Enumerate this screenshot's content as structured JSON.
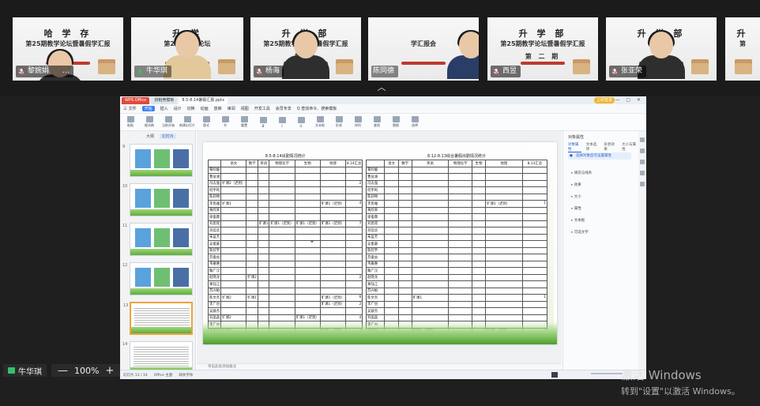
{
  "participants": [
    {
      "name": "黎婉娟",
      "slide_title": "哈 学 存",
      "slide_subtitle": "第25期教学论坛暨暑假学汇报",
      "slide_line3": "",
      "has_person": true,
      "muted": true,
      "more": "…"
    },
    {
      "name": "牛华琪",
      "slide_title": "升 学",
      "slide_subtitle": "第25期教学论坛",
      "slide_line3": "第",
      "has_person": true,
      "muted": false,
      "active": true
    },
    {
      "name": "杨海",
      "slide_title": "升 学 部",
      "slide_subtitle": "第25期教学论坛暨暑假学汇报",
      "slide_line3": "第 期",
      "has_person": true,
      "muted": true
    },
    {
      "name": "陈同德",
      "slide_title": "",
      "slide_subtitle": "学汇报会",
      "slide_line3": "",
      "has_person": true,
      "muted": false
    },
    {
      "name": "西昱",
      "slide_title": "升 学 部",
      "slide_subtitle": "第25期教学论坛暨暑假学汇报",
      "slide_line3": "第 二 期",
      "has_person": false,
      "muted": true
    },
    {
      "name": "张亚荣",
      "slide_title": "升 学 部",
      "slide_subtitle": "学汇报会",
      "slide_line3": "",
      "has_person": true,
      "muted": true
    },
    {
      "name": "",
      "slide_title": "升",
      "slide_subtitle": "第",
      "slide_line3": "",
      "has_person": false,
      "muted": false
    }
  ],
  "app": {
    "tabs": [
      "WPS Office",
      "找稻壳模板",
      "8.5-8.14暑假汇报.pptx"
    ],
    "login_label": "立即登录",
    "menus": [
      "三 文件",
      "开始",
      "插入",
      "设计",
      "切换",
      "动画",
      "放映",
      "审阅",
      "视图",
      "开发工具",
      "会员专享",
      "Q 查找命令、搜索模板"
    ],
    "active_menu": "开始",
    "ribbon": [
      "粘贴",
      "格式刷",
      "当前开始",
      "新建幻灯片",
      "版式",
      "节",
      "重置",
      "B",
      "I",
      "U",
      "文本框",
      "形状",
      "排列",
      "查找",
      "替换",
      "选择"
    ],
    "thumb_tabs": [
      "大纲",
      "幻灯片"
    ],
    "thumb_numbers": [
      "9",
      "10",
      "11",
      "12",
      "13",
      "14"
    ],
    "notes_placeholder": "单击此处添加备注",
    "status": [
      "幻灯片 13 / 14",
      "Office 主题",
      "缺失字体"
    ],
    "right_pane_title": "对象属性",
    "right_pane_tabs": [
      "对象属性",
      "文本选项",
      "形状效果",
      "大小与属性"
    ],
    "right_pane_info": "选择对象后可设置属性",
    "right_pane_items": [
      "填充与线条",
      "效果",
      "大小",
      "属性",
      "文本框",
      "可选文字"
    ]
  },
  "table_left": {
    "caption": "8.5-8.14出勤情况统计",
    "headers": [
      "",
      "语文",
      "数学",
      "英语",
      "物理化学",
      "生物",
      "地理",
      "8.14汇总"
    ],
    "rows": [
      [
        "覃欣媛",
        "",
        "",
        "",
        "",
        "",
        "",
        ""
      ],
      [
        "曹益涵",
        "",
        "",
        "",
        "",
        "",
        "",
        ""
      ],
      [
        "冯志强",
        "旷课2（迟到）",
        "",
        "",
        "",
        "",
        "",
        "2"
      ],
      [
        "何宇鸣",
        "",
        "",
        "",
        "",
        "",
        "",
        ""
      ],
      [
        "陈舒畅",
        "",
        "",
        "",
        "",
        "",
        "",
        ""
      ],
      [
        "李思雅",
        "旷课1",
        "",
        "",
        "",
        "",
        "旷课1（迟到）",
        "4"
      ],
      [
        "黄欣来",
        "",
        "",
        "",
        "",
        "",
        "",
        ""
      ],
      [
        "梁俊霖",
        "",
        "",
        "",
        "",
        "",
        "",
        ""
      ],
      [
        "刘思瑶",
        "",
        "",
        "旷课1",
        "旷课1（迟到）",
        "旷课1（迟到）",
        "旷课1（迟到）",
        "7"
      ],
      [
        "邓蕊华",
        "",
        "",
        "",
        "",
        "",
        "",
        ""
      ],
      [
        "朱蓝芳",
        "",
        "",
        "",
        "",
        "",
        "",
        ""
      ],
      [
        "吴俊豪",
        "",
        "",
        "",
        "",
        "",
        "",
        ""
      ],
      [
        "陈欣宇",
        "",
        "",
        "",
        "",
        "",
        "",
        ""
      ],
      [
        "苏俊益",
        "",
        "",
        "",
        "",
        "",
        "",
        ""
      ],
      [
        "韦嘉惠",
        "",
        "",
        "",
        "",
        "",
        "",
        ""
      ],
      [
        "鞠广汉",
        "",
        "",
        "",
        "",
        "",
        "",
        ""
      ],
      [
        "赵晓龙",
        "",
        "旷课2",
        "",
        "",
        "",
        "",
        "2"
      ],
      [
        "黄钰江",
        "",
        "",
        "",
        "",
        "",
        "",
        ""
      ],
      [
        "苏兴柏",
        "",
        "",
        "",
        "",
        "",
        "",
        ""
      ],
      [
        "陈文杰",
        "旷课2",
        "旷课1",
        "",
        "",
        "",
        "旷课1（迟到）",
        "6"
      ],
      [
        "李广创",
        "",
        "",
        "",
        "",
        "",
        "旷课1（迟到）",
        "2"
      ],
      [
        "吴骏杰",
        "",
        "",
        "",
        "",
        "",
        "",
        ""
      ],
      [
        "刘晶晶",
        "旷课2",
        "",
        "",
        "",
        "旷课1（迟到）",
        "",
        "4"
      ],
      [
        "李广兴",
        "",
        "",
        "",
        "",
        "",
        "",
        ""
      ],
      [
        "王嘉阳",
        "旷课2",
        "",
        "",
        "",
        "",
        "旷课1（迟到）",
        "3"
      ]
    ]
  },
  "table_right": {
    "caption": "8.12-8.13综合暑假出勤情况统计",
    "headers": [
      "",
      "语文",
      "数学",
      "英语",
      "物理化学",
      "生物",
      "地理",
      "8.13汇总"
    ],
    "rows": [
      [
        "覃欣媛",
        "",
        "",
        "",
        "",
        "",
        "",
        ""
      ],
      [
        "曹益涵",
        "",
        "",
        "",
        "",
        "",
        "",
        ""
      ],
      [
        "冯志强",
        "",
        "",
        "",
        "",
        "",
        "",
        ""
      ],
      [
        "何宇鸣",
        "",
        "",
        "",
        "",
        "",
        "",
        ""
      ],
      [
        "陈舒畅",
        "",
        "",
        "",
        "",
        "",
        "",
        ""
      ],
      [
        "李思雅",
        "",
        "",
        "",
        "",
        "",
        "旷课1（迟到）",
        "1"
      ],
      [
        "黄欣来",
        "",
        "",
        "",
        "",
        "",
        "",
        ""
      ],
      [
        "梁俊霖",
        "",
        "",
        "",
        "",
        "",
        "",
        ""
      ],
      [
        "刘思瑶",
        "",
        "",
        "",
        "",
        "",
        "",
        ""
      ],
      [
        "邓蕊华",
        "",
        "",
        "",
        "",
        "",
        "",
        ""
      ],
      [
        "朱蓝芳",
        "",
        "",
        "",
        "",
        "",
        "",
        ""
      ],
      [
        "吴俊豪",
        "",
        "",
        "",
        "",
        "",
        "",
        ""
      ],
      [
        "陈欣宇",
        "",
        "",
        "",
        "",
        "",
        "",
        ""
      ],
      [
        "苏俊益",
        "",
        "",
        "",
        "",
        "",
        "",
        ""
      ],
      [
        "韦嘉惠",
        "",
        "",
        "",
        "",
        "",
        "",
        ""
      ],
      [
        "鞠广汉",
        "",
        "",
        "",
        "",
        "",
        "",
        ""
      ],
      [
        "赵晓龙",
        "",
        "",
        "",
        "",
        "",
        "",
        ""
      ],
      [
        "黄钰江",
        "",
        "",
        "",
        "",
        "",
        "",
        ""
      ],
      [
        "苏兴柏",
        "",
        "",
        "",
        "",
        "",
        "",
        ""
      ],
      [
        "陈文杰",
        "",
        "",
        "旷课1",
        "",
        "",
        "",
        "1"
      ],
      [
        "李广创",
        "",
        "",
        "",
        "",
        "",
        "",
        ""
      ],
      [
        "吴骏杰",
        "",
        "",
        "",
        "",
        "",
        "",
        ""
      ],
      [
        "刘晶晶",
        "",
        "",
        "",
        "",
        "",
        "",
        ""
      ],
      [
        "李广兴",
        "",
        "",
        "",
        "",
        "",
        "",
        ""
      ],
      [
        "王嘉阳",
        "",
        "",
        "旷课1（迟到）",
        "",
        "",
        "旷课1（迟到）",
        "4"
      ]
    ]
  },
  "bottom": {
    "sharer_name": "牛华琪",
    "zoom_minus": "—",
    "zoom_value": "100%",
    "zoom_plus": "+"
  },
  "watermark": {
    "line1": "激活 Windows",
    "line2": "转到\"设置\"以激活 Windows。"
  },
  "colors": {
    "active_speaker": "#33c06b",
    "wps_brand": "#e24a3b",
    "accent_blue": "#2b62c9"
  }
}
